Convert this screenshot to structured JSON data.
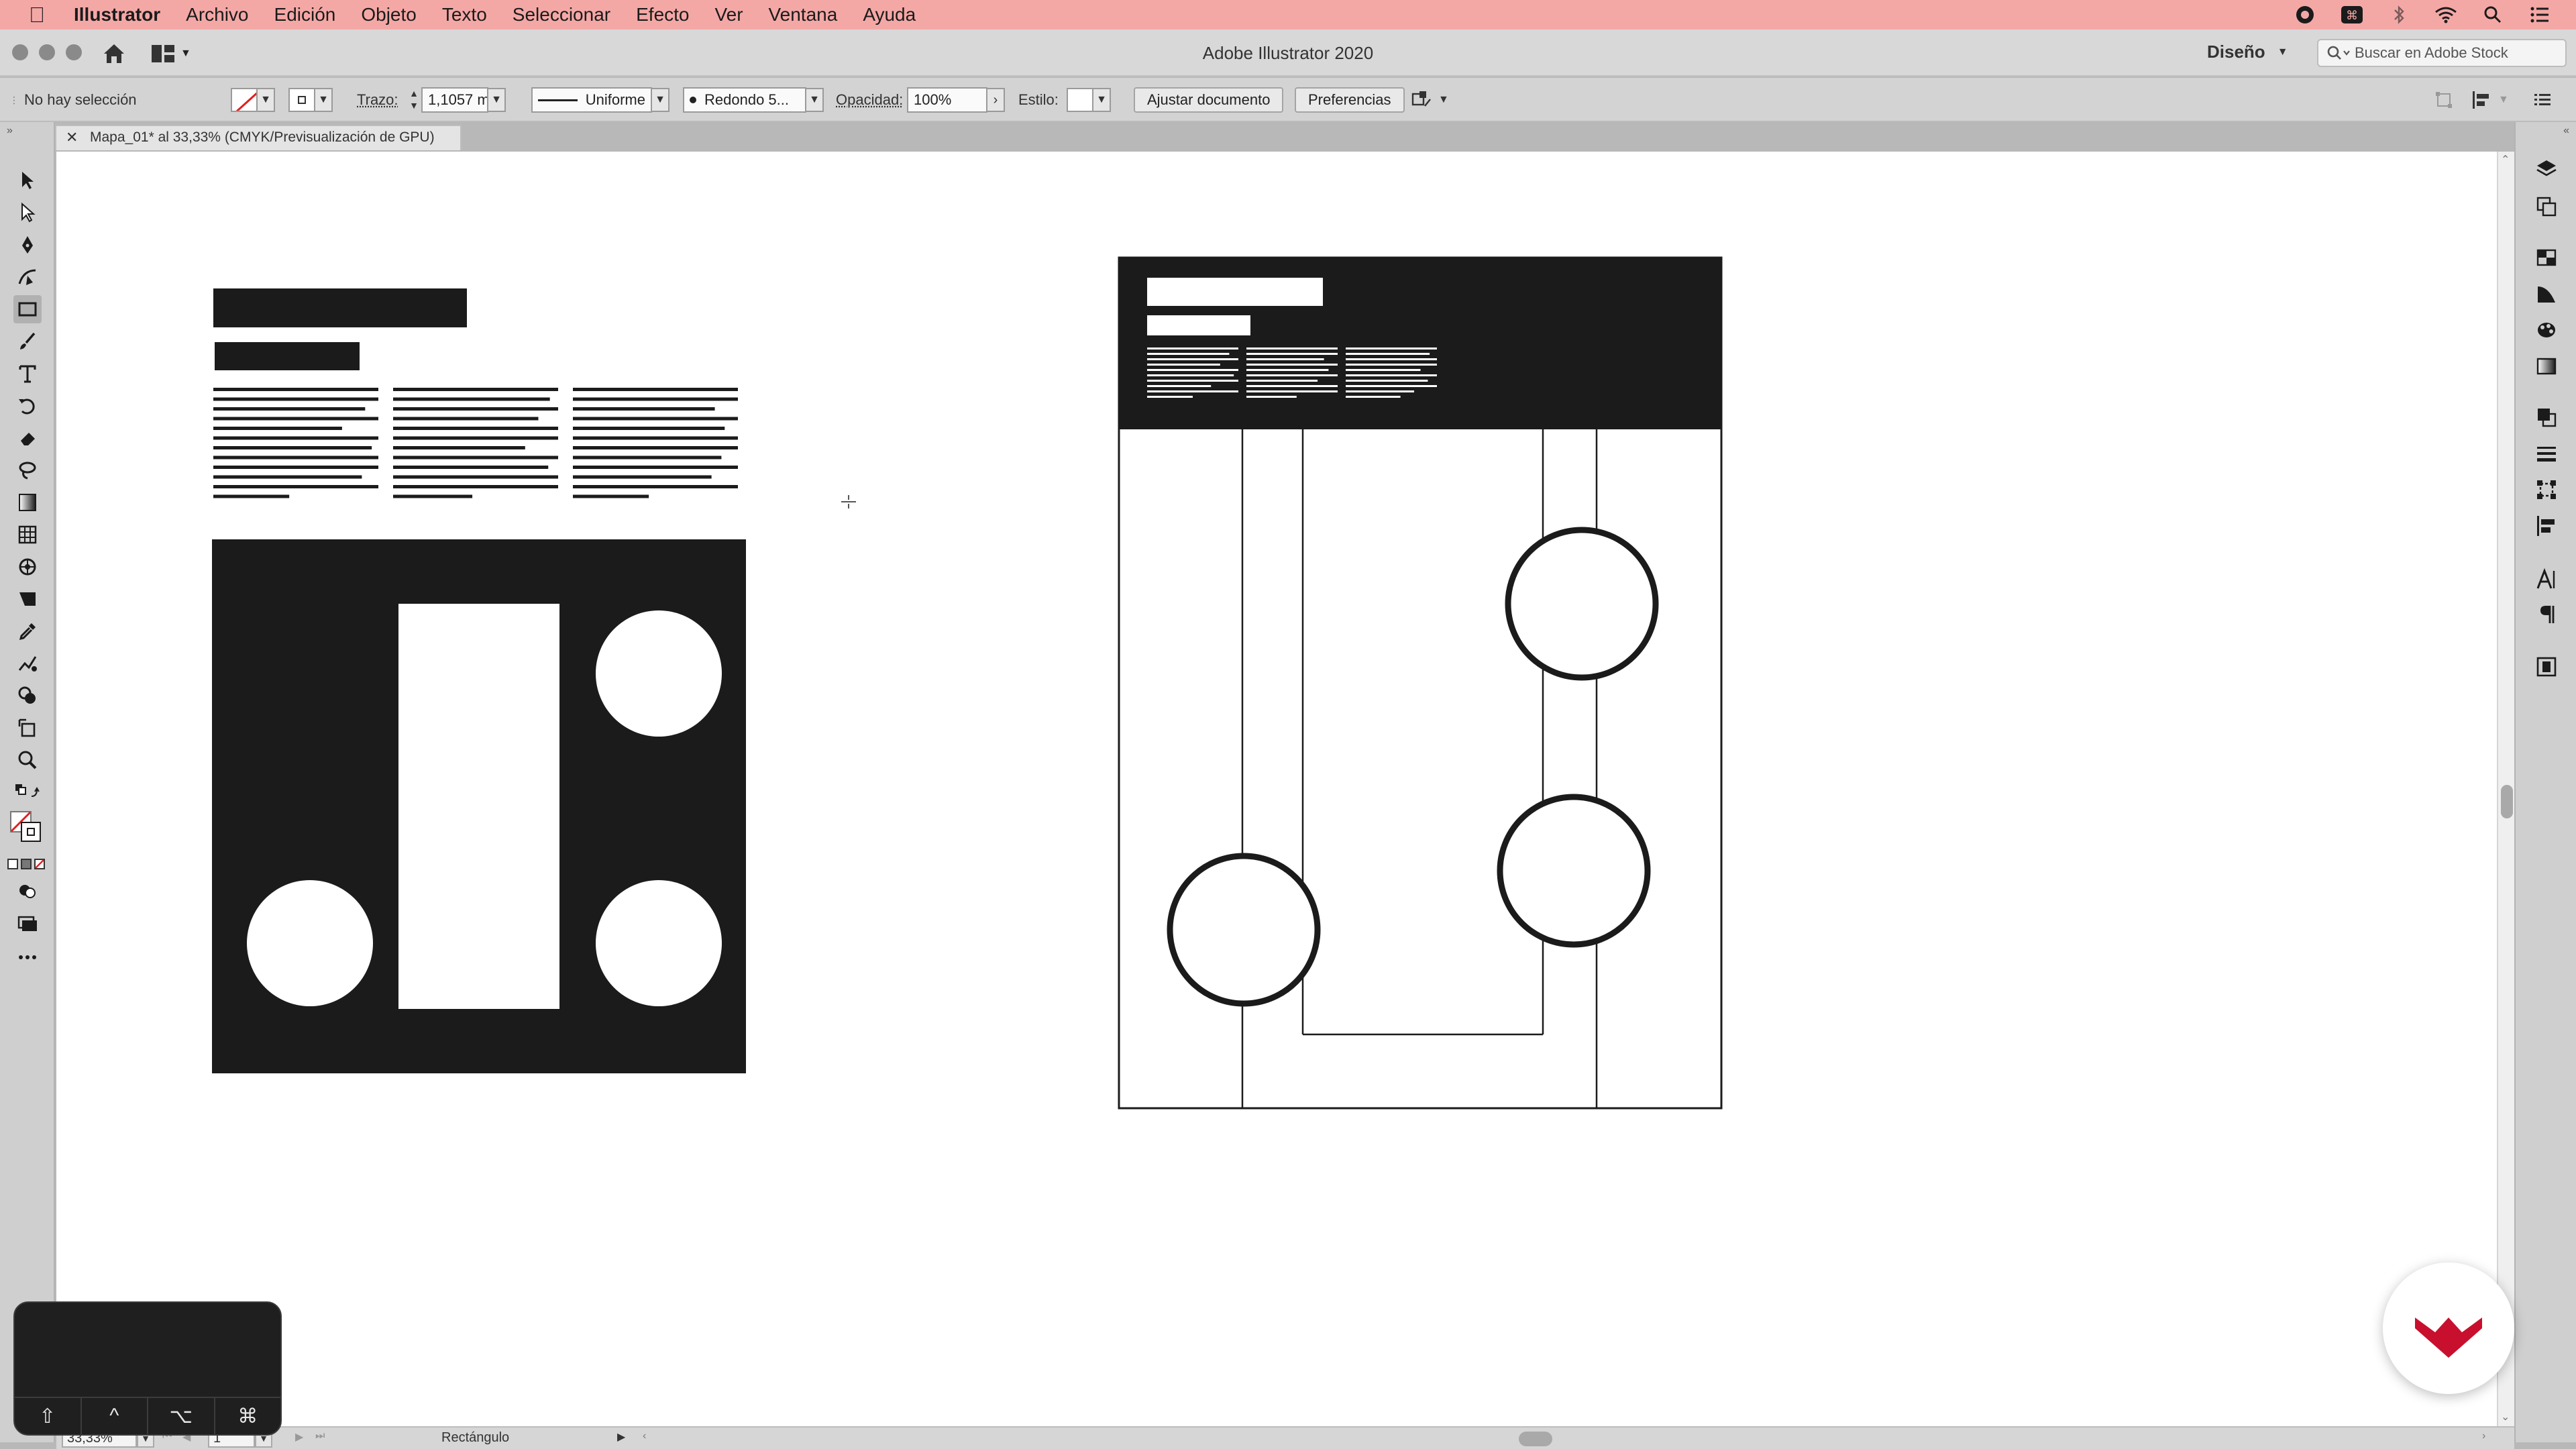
{
  "menubar": {
    "app": "Illustrator",
    "items": [
      "Archivo",
      "Edición",
      "Objeto",
      "Texto",
      "Seleccionar",
      "Efecto",
      "Ver",
      "Ventana",
      "Ayuda"
    ]
  },
  "window": {
    "title": "Adobe Illustrator 2020",
    "workspace": "Diseño",
    "stock_search_placeholder": "Buscar en Adobe Stock"
  },
  "control": {
    "selection_status": "No hay selección",
    "stroke_label": "Trazo:",
    "stroke_weight": "1,1057 m",
    "profile": "Uniforme",
    "brush": "Redondo 5...",
    "opacity_label": "Opacidad:",
    "opacity": "100%",
    "style_label": "Estilo:",
    "document_setup_button": "Ajustar documento",
    "preferences_button": "Preferencias"
  },
  "document": {
    "tab_title": "Mapa_01* al 33,33% (CMYK/Previsualización de GPU)"
  },
  "status": {
    "zoom": "33,33%",
    "artboard": "1",
    "current_tool": "Rectángulo"
  },
  "keyboard_overlay": {
    "keys": [
      "⇧",
      "^",
      "⌥",
      "⌘"
    ]
  },
  "colors": {
    "menubar_bg": "#f4a8a6",
    "artwork_fill": "#1b1b1b",
    "brand": "#c8102e"
  }
}
